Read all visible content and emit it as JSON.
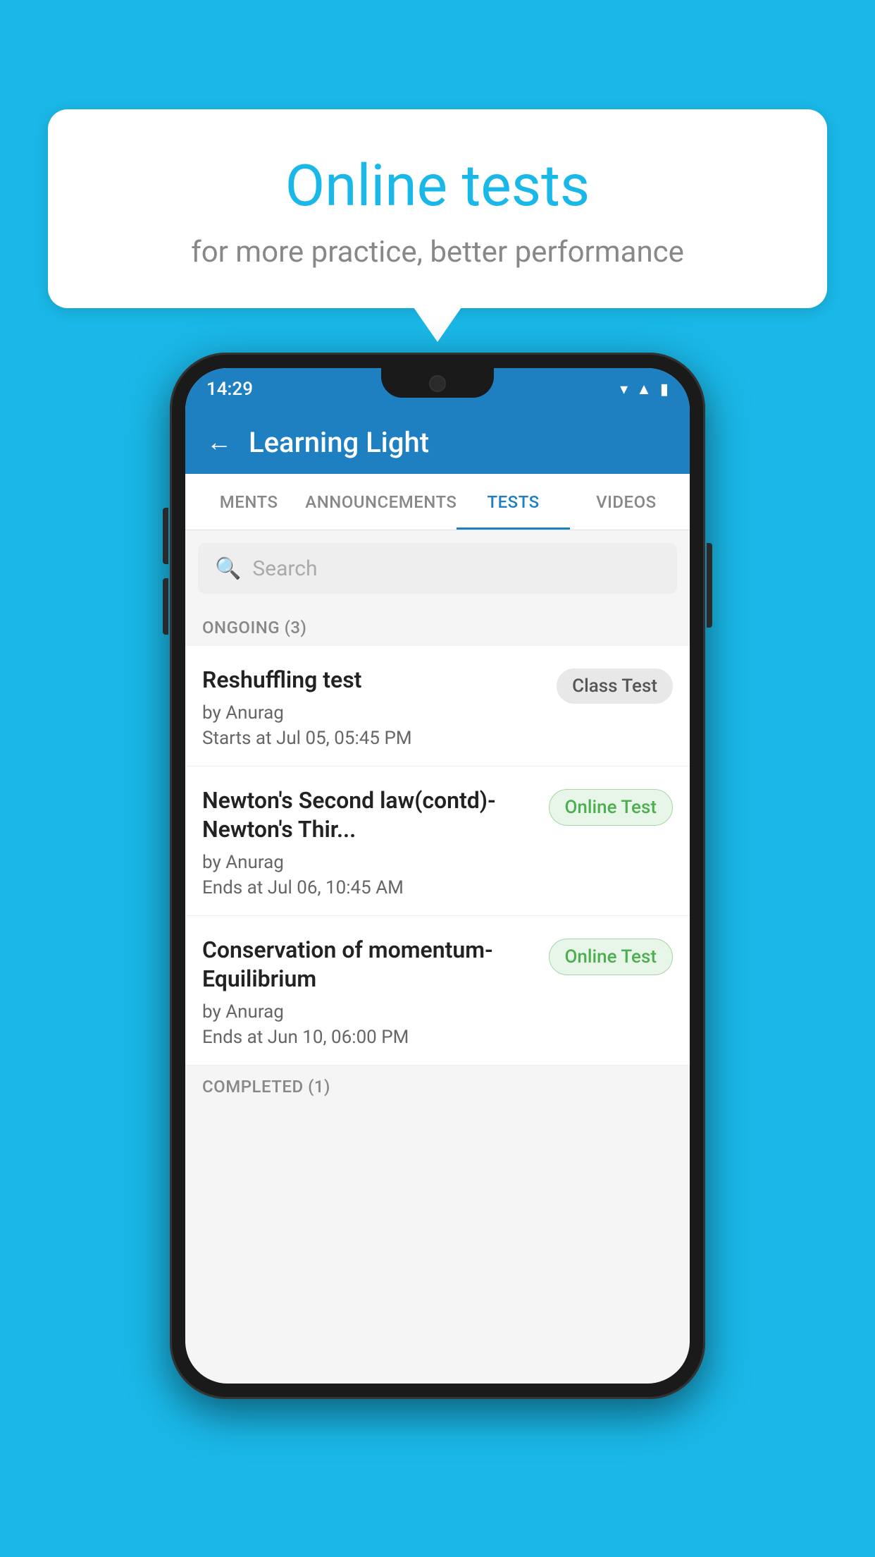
{
  "background": {
    "color": "#1ab8e8"
  },
  "speech_bubble": {
    "title": "Online tests",
    "subtitle": "for more practice, better performance"
  },
  "phone": {
    "status_bar": {
      "time": "14:29",
      "icons": [
        "wifi",
        "signal",
        "battery"
      ]
    },
    "app_header": {
      "back_label": "←",
      "title": "Learning Light"
    },
    "tabs": [
      {
        "label": "MENTS",
        "active": false
      },
      {
        "label": "ANNOUNCEMENTS",
        "active": false
      },
      {
        "label": "TESTS",
        "active": true
      },
      {
        "label": "VIDEOS",
        "active": false
      }
    ],
    "search": {
      "placeholder": "Search"
    },
    "sections": [
      {
        "header": "ONGOING (3)",
        "items": [
          {
            "title": "Reshuffling test",
            "author": "by Anurag",
            "time": "Starts at  Jul 05, 05:45 PM",
            "badge": "Class Test",
            "badge_type": "class"
          },
          {
            "title": "Newton's Second law(contd)-Newton's Thir...",
            "author": "by Anurag",
            "time": "Ends at  Jul 06, 10:45 AM",
            "badge": "Online Test",
            "badge_type": "online"
          },
          {
            "title": "Conservation of momentum-Equilibrium",
            "author": "by Anurag",
            "time": "Ends at  Jun 10, 06:00 PM",
            "badge": "Online Test",
            "badge_type": "online"
          }
        ]
      },
      {
        "header": "COMPLETED (1)",
        "items": []
      }
    ]
  }
}
